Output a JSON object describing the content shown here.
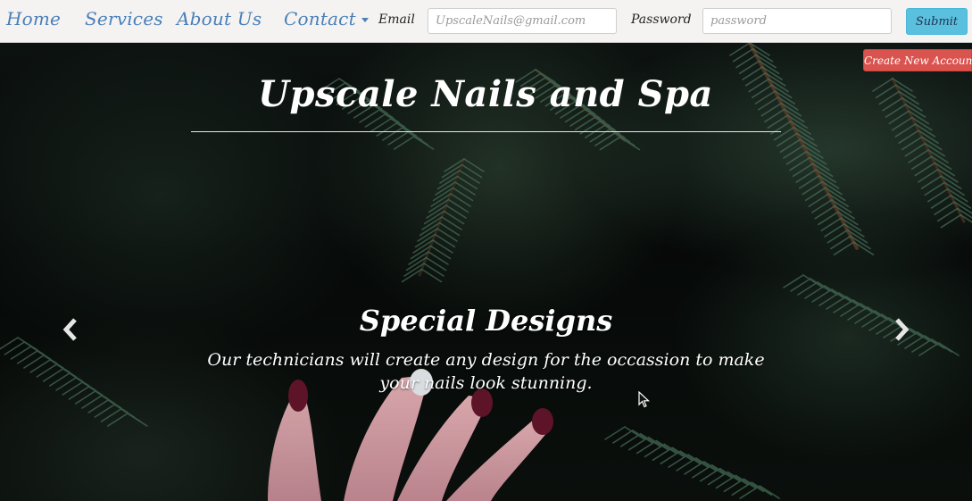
{
  "navbar": {
    "links": [
      "Home",
      "Services",
      "About Us",
      "Contact"
    ],
    "email_label": "Email",
    "email_placeholder": "UpscaleNails@gmail.com",
    "password_label": "Password",
    "password_placeholder": "password",
    "submit_label": "Submit",
    "link_color": "#4a7fb8",
    "submit_color": "#5bc0de"
  },
  "hero": {
    "create_account_label": "Create New Account",
    "create_account_color": "#d9534f",
    "title": "Upscale Nails and Spa",
    "slide": {
      "heading": "Special Designs",
      "text": "Our technicians will create any design for the occassion to make your nails look stunning."
    },
    "prev_icon": "chevron-left-icon",
    "next_icon": "chevron-right-icon"
  }
}
